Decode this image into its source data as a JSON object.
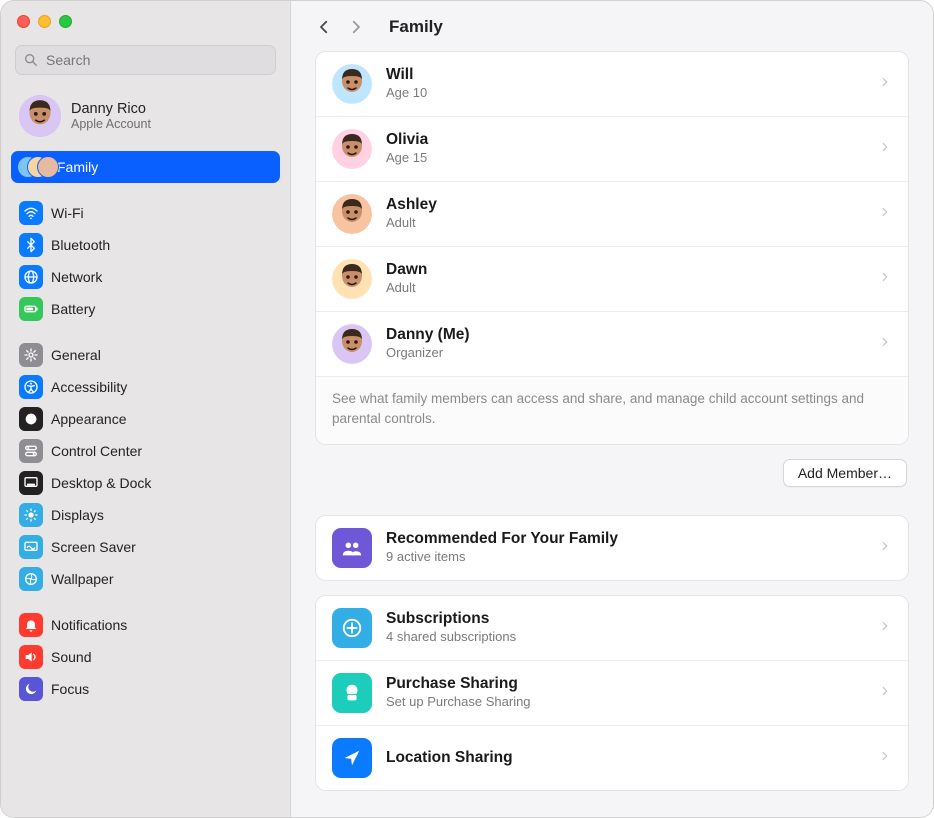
{
  "window": {
    "title": "Family"
  },
  "search": {
    "placeholder": "Search"
  },
  "account": {
    "name": "Danny Rico",
    "sub": "Apple Account"
  },
  "sidebar": {
    "family": "Family",
    "items": [
      {
        "label": "Wi-Fi",
        "icon": "wifi",
        "bg": "bg-blue"
      },
      {
        "label": "Bluetooth",
        "icon": "bluetooth",
        "bg": "bg-blue"
      },
      {
        "label": "Network",
        "icon": "globe",
        "bg": "bg-blue"
      },
      {
        "label": "Battery",
        "icon": "battery",
        "bg": "bg-green"
      },
      {
        "label": "General",
        "icon": "gear",
        "bg": "bg-grey"
      },
      {
        "label": "Accessibility",
        "icon": "accessibility",
        "bg": "bg-blue"
      },
      {
        "label": "Appearance",
        "icon": "appearance",
        "bg": "bg-black"
      },
      {
        "label": "Control Center",
        "icon": "switches",
        "bg": "bg-grey"
      },
      {
        "label": "Desktop & Dock",
        "icon": "dock",
        "bg": "bg-black"
      },
      {
        "label": "Displays",
        "icon": "display",
        "bg": "bg-cyan"
      },
      {
        "label": "Screen Saver",
        "icon": "screensaver",
        "bg": "bg-cyan"
      },
      {
        "label": "Wallpaper",
        "icon": "wallpaper",
        "bg": "bg-cyan"
      },
      {
        "label": "Notifications",
        "icon": "bell",
        "bg": "bg-red"
      },
      {
        "label": "Sound",
        "icon": "speaker",
        "bg": "bg-red"
      },
      {
        "label": "Focus",
        "icon": "moon",
        "bg": "bg-indigo"
      }
    ]
  },
  "members": [
    {
      "name": "Will",
      "sub": "Age 10",
      "bg": "#bfe6ff"
    },
    {
      "name": "Olivia",
      "sub": "Age 15",
      "bg": "#ffd1e3"
    },
    {
      "name": "Ashley",
      "sub": "Adult",
      "bg": "#f7c3a0"
    },
    {
      "name": "Dawn",
      "sub": "Adult",
      "bg": "#ffe1b3"
    },
    {
      "name": "Danny (Me)",
      "sub": "Organizer",
      "bg": "#d9c6f5"
    }
  ],
  "members_note": "See what family members can access and share, and manage child account settings and parental controls.",
  "add_member": "Add Member…",
  "cards": {
    "recommended": {
      "title": "Recommended For Your Family",
      "sub": "9 active items"
    },
    "subscriptions": {
      "title": "Subscriptions",
      "sub": "4 shared subscriptions"
    },
    "purchase": {
      "title": "Purchase Sharing",
      "sub": "Set up Purchase Sharing"
    },
    "location": {
      "title": "Location Sharing",
      "sub": ""
    }
  }
}
